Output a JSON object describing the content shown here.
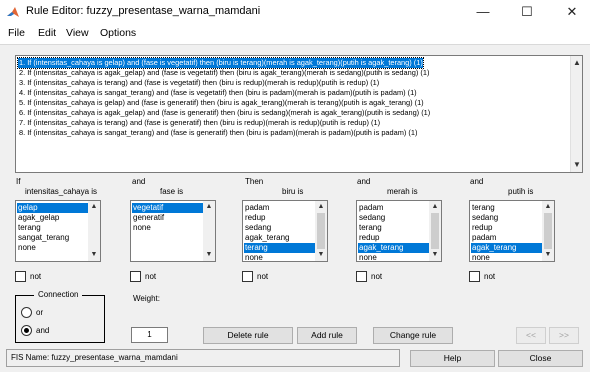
{
  "window": {
    "title": "Rule Editor: fuzzy_presentase_warna_mamdani",
    "controls": {
      "minimize": "—",
      "maximize": "☐",
      "close": "✕"
    }
  },
  "menu": [
    "File",
    "Edit",
    "View",
    "Options"
  ],
  "rules": [
    "1. If (intensitas_cahaya is gelap) and (fase is vegetatif) then (biru is terang)(merah is agak_terang)(putih is agak_terang) (1)",
    "2. If (intensitas_cahaya is agak_gelap) and (fase is vegetatif) then (biru is agak_terang)(merah is sedang)(putih is sedang) (1)",
    "3. If (intensitas_cahaya is terang) and (fase is vegetatif) then (biru is redup)(merah is redup)(putih is redup) (1)",
    "4. If (intensitas_cahaya is sangat_terang) and (fase is vegetatif) then (biru is padam)(merah is padam)(putih is padam) (1)",
    "5. If (intensitas_cahaya is gelap) and (fase is generatif) then (biru is agak_terang)(merah is terang)(putih is agak_terang) (1)",
    "6. If (intensitas_cahaya is agak_gelap) and (fase is generatif) then (biru is sedang)(merah is agak_terang)(putih is sedang) (1)",
    "7. If (intensitas_cahaya is terang) and (fase is generatif) then (biru is redup)(merah is redup)(putih is redup) (1)",
    "8. If (intensitas_cahaya is sangat_terang) and (fase is generatif) then (biru is padam)(merah is padam)(putih is padam) (1)"
  ],
  "selected_rule": 1,
  "columns": [
    {
      "prefix": "If",
      "var_label": "intensitas_cahaya is",
      "items": [
        "gelap",
        "agak_gelap",
        "terang",
        "sangat_terang",
        "none"
      ],
      "selected": "gelap",
      "not_label": "not"
    },
    {
      "prefix": "and",
      "var_label": "fase is",
      "items": [
        "vegetatif",
        "generatif",
        "none"
      ],
      "selected": "vegetatif",
      "not_label": "not"
    },
    {
      "prefix": "Then",
      "var_label": "biru is",
      "items": [
        "padam",
        "redup",
        "sedang",
        "agak_terang",
        "terang",
        "none"
      ],
      "selected": "terang",
      "not_label": "not"
    },
    {
      "prefix": "and",
      "var_label": "merah is",
      "items": [
        "padam",
        "sedang",
        "terang",
        "redup",
        "agak_terang",
        "none"
      ],
      "selected": "agak_terang",
      "not_label": "not"
    },
    {
      "prefix": "and",
      "var_label": "putih is",
      "items": [
        "terang",
        "sedang",
        "redup",
        "padam",
        "agak_terang",
        "none"
      ],
      "selected": "agak_terang",
      "not_label": "not"
    }
  ],
  "connection": {
    "label": "Connection",
    "options": [
      "or",
      "and"
    ],
    "selected": "and"
  },
  "weight": {
    "label": "Weight:",
    "value": "1"
  },
  "buttons": {
    "delete_rule": "Delete rule",
    "add_rule": "Add rule",
    "change_rule": "Change rule",
    "prev": "<<",
    "next": ">>",
    "help": "Help",
    "close": "Close"
  },
  "status": "FIS Name: fuzzy_presentase_warna_mamdani",
  "colors": {
    "selection": "#0078d7",
    "panel": "#f0f0f0"
  }
}
